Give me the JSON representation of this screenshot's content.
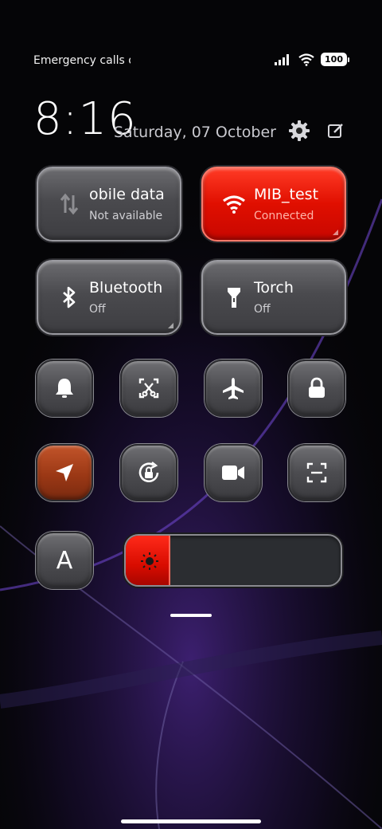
{
  "status_bar": {
    "carrier": "Emergency calls o",
    "battery": "100"
  },
  "header": {
    "time": "8:16",
    "date": "Saturday, 07 October"
  },
  "tiles": {
    "mobile_data": {
      "title": "obile data",
      "subtitle": "Not available"
    },
    "wifi": {
      "title": "MIB_test",
      "subtitle": "Connected"
    },
    "bluetooth": {
      "title": "Bluetooth",
      "subtitle": "Off"
    },
    "torch": {
      "title": "Torch",
      "subtitle": "Off"
    }
  },
  "toggles_row1": [
    "bell-icon",
    "screenshot-icon",
    "airplane-icon",
    "lock-icon"
  ],
  "toggles_row2": [
    "location-icon",
    "auto-rotate-icon",
    "video-icon",
    "scan-icon"
  ],
  "font_button": {
    "label": "A"
  },
  "brightness": {
    "level": 0.2
  },
  "colors": {
    "accent_red": "#e00f00",
    "location_orange": "#a23c17"
  }
}
